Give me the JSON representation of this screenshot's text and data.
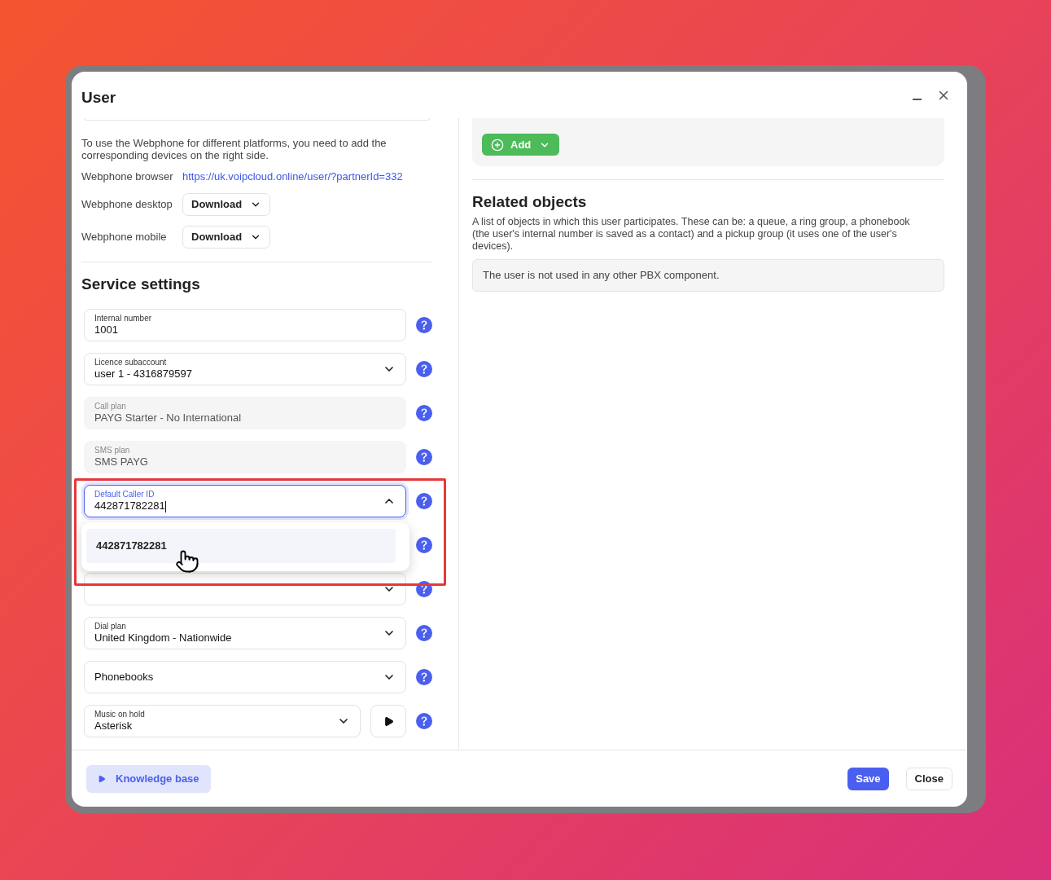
{
  "dialog": {
    "title": "User"
  },
  "webphone": {
    "description": "To use the Webphone for different platforms, you need to add the corresponding devices on the right side.",
    "rows": [
      {
        "kind": "link",
        "label": "Webphone browser",
        "value": "https://uk.voipcloud.online/user/?partnerId=332"
      },
      {
        "kind": "dropdown",
        "label": "Webphone desktop",
        "value": "Download"
      },
      {
        "kind": "dropdown",
        "label": "Webphone mobile",
        "value": "Download"
      }
    ]
  },
  "service_settings": {
    "title": "Service settings",
    "fields": [
      {
        "kind": "text",
        "label": "Internal number",
        "value": "1001",
        "disabled": false
      },
      {
        "kind": "select",
        "label": "Licence subaccount",
        "value": "user 1 - 4316879597",
        "disabled": false,
        "expanded": false
      },
      {
        "kind": "text",
        "label": "Call plan",
        "value": "PAYG Starter - No International",
        "disabled": true
      },
      {
        "kind": "text",
        "label": "SMS plan",
        "value": "SMS PAYG",
        "disabled": true
      },
      {
        "kind": "combobox",
        "label": "Default Caller ID",
        "value": "442871782281",
        "disabled": false,
        "expanded": true,
        "options": [
          {
            "label": "442871782281",
            "selected": true
          }
        ]
      },
      {
        "kind": "covered"
      },
      {
        "kind": "select",
        "disabled": false,
        "expanded": false
      },
      {
        "kind": "select",
        "label": "Dial plan",
        "value": "United Kingdom - Nationwide",
        "disabled": false,
        "expanded": false
      },
      {
        "kind": "select",
        "placeholder": "Phonebooks",
        "disabled": false,
        "expanded": false
      },
      {
        "kind": "player",
        "label": "Music on hold",
        "value": "Asterisk",
        "disabled": false,
        "expanded": false
      }
    ]
  },
  "devices": {
    "add_button": "Add"
  },
  "related_objects": {
    "title": "Related objects",
    "description": "A list of objects in which this user participates. These can be: a queue, a ring group, a phonebook (the user's internal number is saved as a contact) and a pickup group (it uses one of the user's devices).",
    "empty_message": "The user is not used in any other PBX component."
  },
  "footer": {
    "knowledge_base": "Knowledge base",
    "buttons": [
      {
        "label": "Save",
        "kind": "primary"
      },
      {
        "label": "Close",
        "kind": "secondary"
      }
    ]
  }
}
